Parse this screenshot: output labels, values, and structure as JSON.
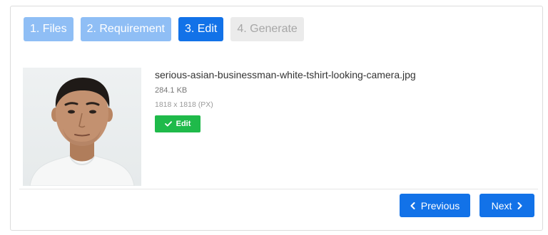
{
  "steps": [
    {
      "label": "1. Files",
      "state": "done"
    },
    {
      "label": "2. Requirement",
      "state": "done"
    },
    {
      "label": "3. Edit",
      "state": "active"
    },
    {
      "label": "4. Generate",
      "state": "future"
    }
  ],
  "file": {
    "name": "serious-asian-businessman-white-tshirt-looking-camera.jpg",
    "size": "284.1 KB",
    "dimensions": "1818 x 1818 (PX)",
    "edit_label": "Edit",
    "edit_icon": "check-icon"
  },
  "nav": {
    "previous_label": "Previous",
    "previous_icon": "chevron-left-icon",
    "next_label": "Next",
    "next_icon": "chevron-right-icon"
  },
  "colors": {
    "accent": "#1272e8",
    "step_done": "#8fbef5",
    "step_future": "#ebebeb",
    "success": "#1fba4a"
  }
}
